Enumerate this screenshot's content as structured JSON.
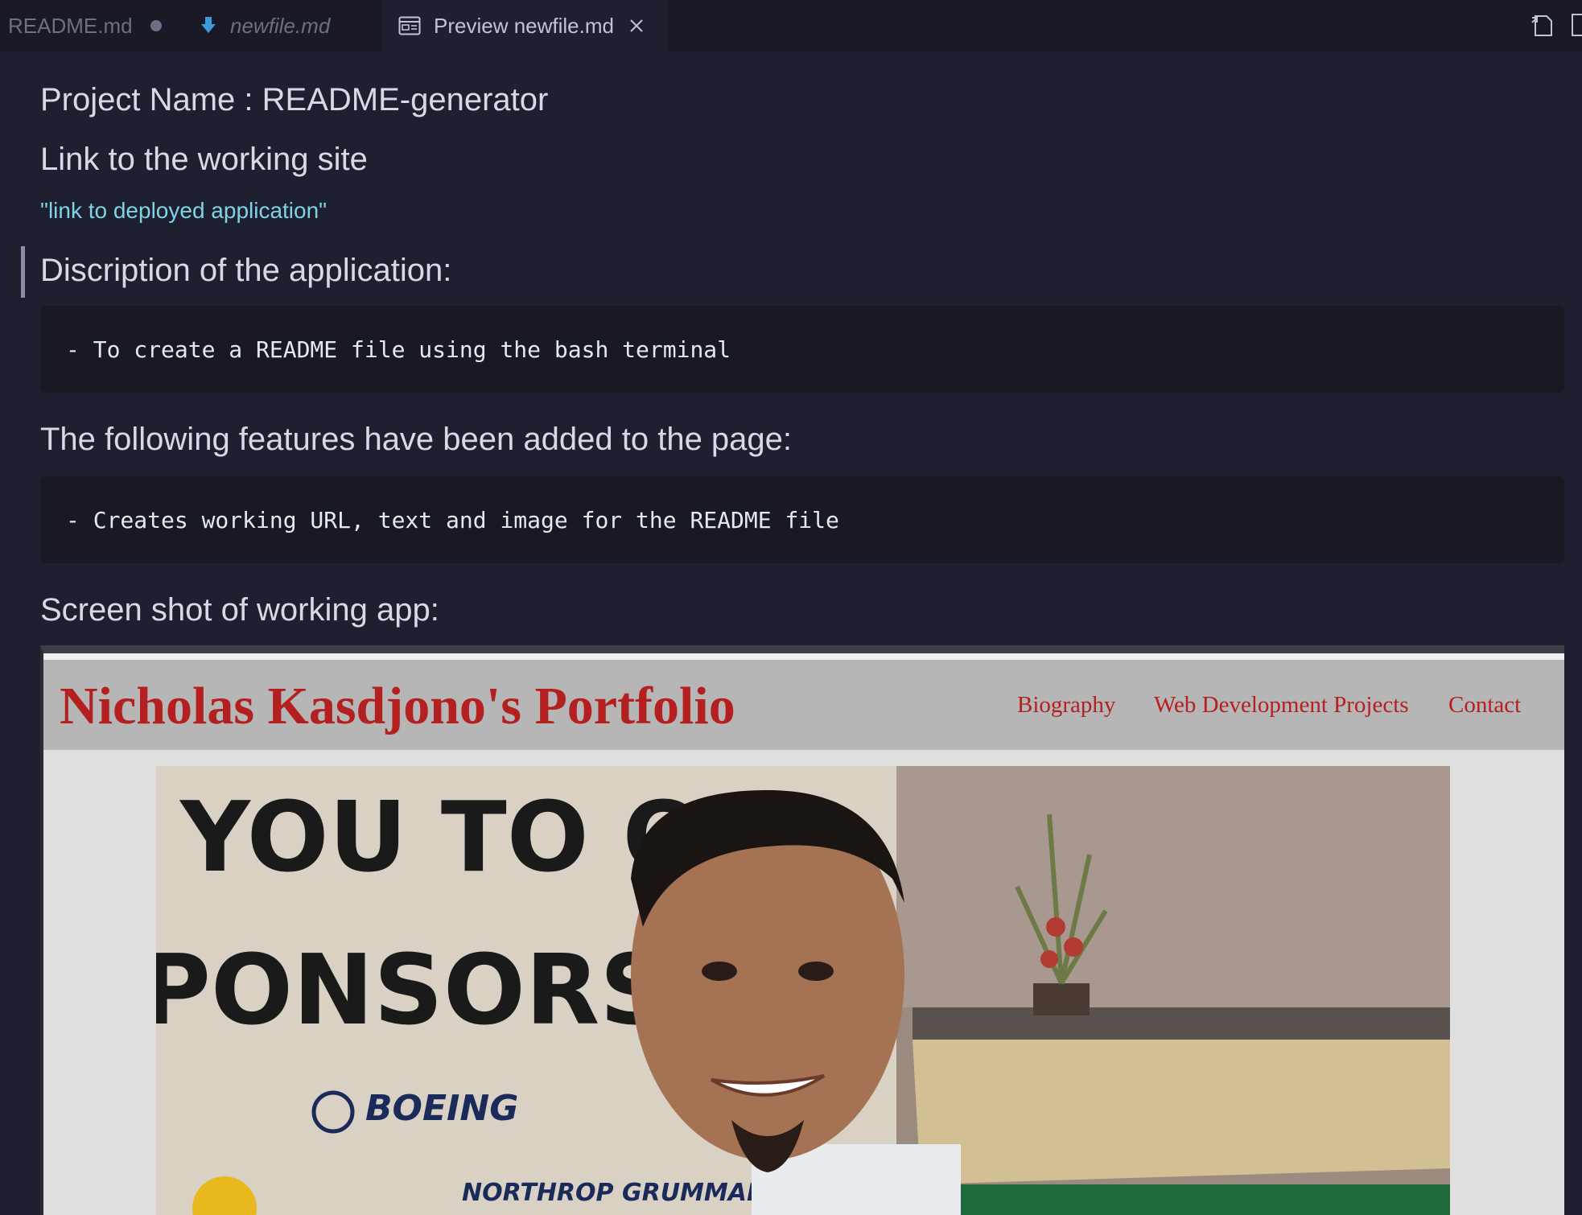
{
  "tabs": [
    {
      "label": "README.md",
      "modified": true
    },
    {
      "label": "newfile.md",
      "italic": true
    },
    {
      "label": "Preview newfile.md",
      "active": true
    }
  ],
  "preview": {
    "project_heading": "Project Name : README-generator",
    "link_heading": "Link to the working site",
    "link_text": "\"link to deployed application\"",
    "description_heading": "Discription of the application:",
    "description_code": "- To create a README file using the bash terminal",
    "features_heading": "The following features have been added to the page:",
    "features_code": "- Creates working URL, text and image for the README file",
    "screenshot_heading": "Screen shot of working app:"
  },
  "screenshot": {
    "site_title": "Nicholas Kasdjono's Portfolio",
    "nav": [
      "Biography",
      "Web Development Projects",
      "Contact"
    ],
    "banner_text_1": "YOU TO OUR",
    "banner_text_2": "PONSORS",
    "sponsor_1": "BOEING",
    "sponsor_2": "NORTHROP GRUMMAN"
  },
  "colors": {
    "editor_bg": "#1e2030",
    "link": "#7fd3e6",
    "site_red": "#b3201f"
  }
}
